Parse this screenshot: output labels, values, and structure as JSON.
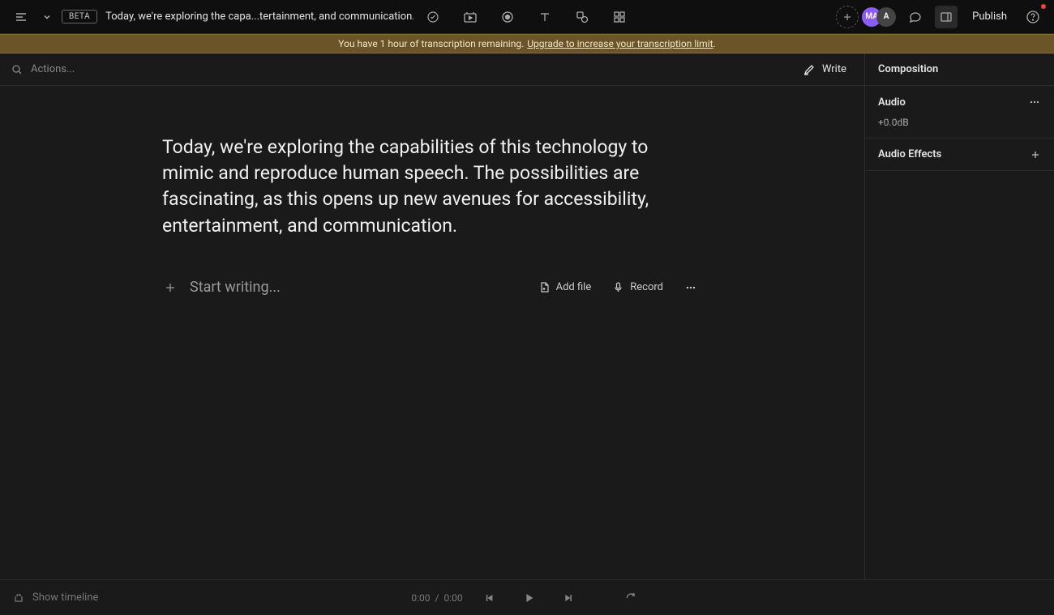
{
  "header": {
    "beta": "BETA",
    "title": "Today, we're exploring the capa...tertainment, and communication.",
    "publish": "Publish",
    "avatar1": "MA",
    "avatar2": "A"
  },
  "banner": {
    "text": "You have 1 hour of transcription remaining.",
    "link": "Upgrade to increase your transcription limit",
    "dot": "."
  },
  "actions": {
    "placeholder": "Actions...",
    "write": "Write"
  },
  "editor": {
    "content": "Today, we're exploring the capabilities of this technology to mimic and reproduce human speech. The possibilities are fascinating, as this opens up new avenues for accessibility, entertainment, and communication.",
    "start_writing": "Start writing...",
    "add_file": "Add file",
    "record": "Record"
  },
  "sidebar": {
    "title": "Composition",
    "audio": {
      "title": "Audio",
      "value": "+0.0dB"
    },
    "effects": {
      "title": "Audio Effects"
    }
  },
  "footer": {
    "show_timeline": "Show timeline",
    "current": "0:00",
    "sep": "/",
    "total": "0:00"
  }
}
